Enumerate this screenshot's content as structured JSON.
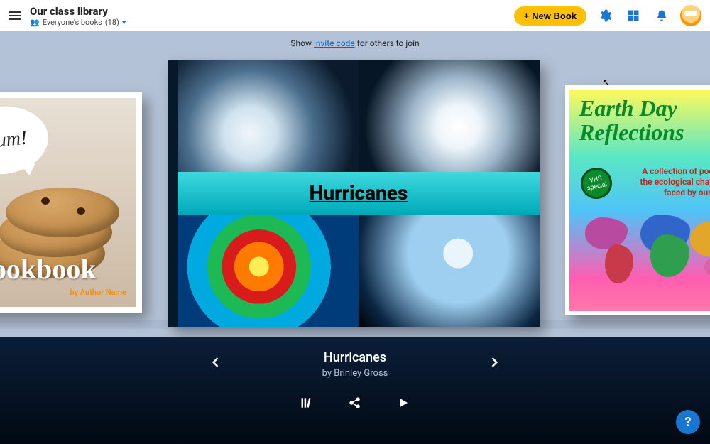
{
  "header": {
    "library_title": "Our class library",
    "subtitle_prefix": "Everyone's books",
    "book_count": "(18)",
    "new_book_label": "New Book"
  },
  "invite": {
    "show_text": "Show ",
    "link_text": "invite code",
    "suffix_text": " for others to join"
  },
  "books": {
    "left": {
      "speech": "m um!",
      "title": "Cookbook",
      "author_line": "by Author Name"
    },
    "center": {
      "title": "Hurricanes"
    },
    "right": {
      "title": "Earth Day Reflections",
      "badge": "VHS special",
      "subtitle": "A collection of poems on the ecological challenges faced by our planet"
    }
  },
  "selected": {
    "title": "Hurricanes",
    "author_line": "by Brinley Gross"
  },
  "icons": {
    "settings": "gear-icon",
    "grid": "grid-icon",
    "bell": "bell-icon",
    "library": "library-icon",
    "share": "share-icon",
    "play": "play-icon",
    "help": "?"
  }
}
